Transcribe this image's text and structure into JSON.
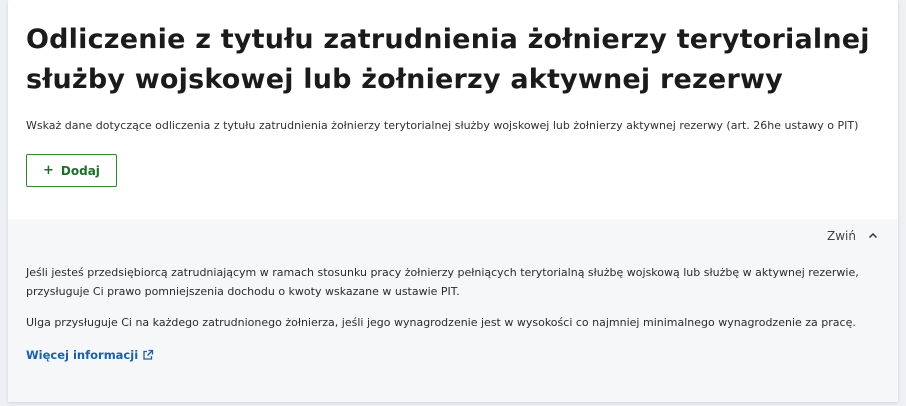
{
  "section": {
    "title": "Odliczenie z tytułu zatrudnienia żołnierzy terytorialnej służby wojskowej lub żołnierzy aktywnej rezerwy",
    "description": "Wskaż dane dotyczące odliczenia z tytułu zatrudnienia żołnierzy terytorialnej służby wojskowej lub żołnierzy aktywnej rezerwy (art. 26he ustawy o PIT)",
    "add_button": {
      "icon": "plus-icon",
      "label": "Dodaj"
    }
  },
  "info_panel": {
    "collapse_label": "Zwiń",
    "collapse_icon": "chevron-up-icon",
    "paragraphs": [
      "Jeśli jesteś przedsiębiorcą zatrudniającym w ramach stosunku pracy żołnierzy pełniących terytorialną służbę wojskową lub służbę w aktywnej rezerwie, przysługuje Ci prawo pomniejszenia dochodu o kwoty wskazane w ustawie PIT.",
      "Ulga przysługuje Ci na każdego zatrudnionego żołnierza, jeśli jego wynagrodzenie jest w wysokości co najmniej minimalnego wynagrodzenie za pracę."
    ],
    "more_link": {
      "label": "Więcej informacji",
      "icon": "external-link-icon"
    }
  },
  "colors": {
    "button_border": "#2a8a30",
    "button_text": "#1f6e27",
    "link": "#1a5fa8",
    "panel_bg": "#f6f7f9"
  }
}
